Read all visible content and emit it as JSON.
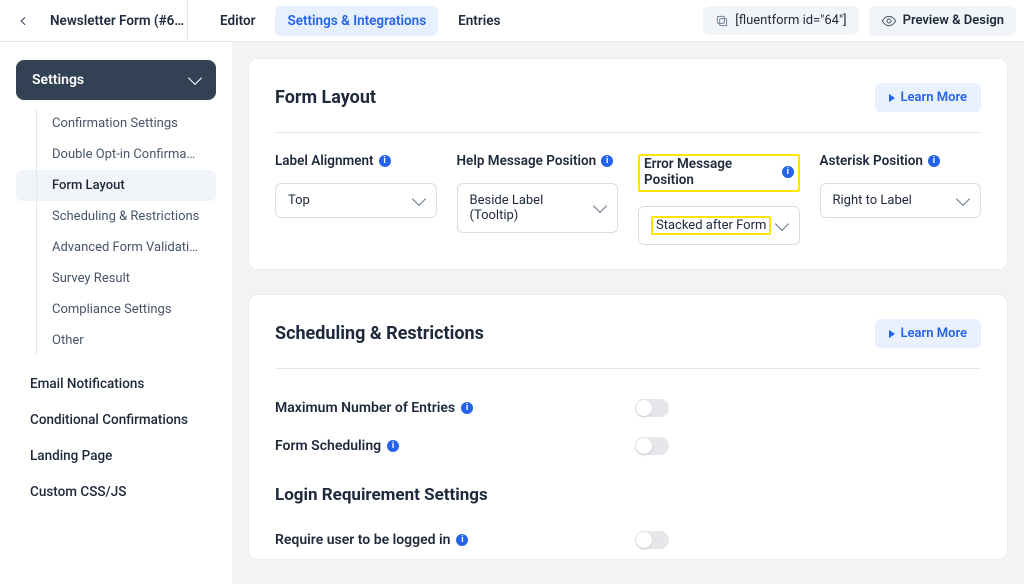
{
  "header": {
    "form_title": "Newsletter Form (#6…",
    "tabs": [
      "Editor",
      "Settings & Integrations",
      "Entries"
    ],
    "shortcode": "[fluentform id=\"64\"]",
    "preview": "Preview & Design"
  },
  "sidebar": {
    "title": "Settings",
    "tree": [
      "Confirmation Settings",
      "Double Opt-in Confirma…",
      "Form Layout",
      "Scheduling & Restrictions",
      "Advanced Form Validati…",
      "Survey Result",
      "Compliance Settings",
      "Other"
    ],
    "links": [
      "Email Notifications",
      "Conditional Confirmations",
      "Landing Page",
      "Custom CSS/JS"
    ]
  },
  "form_layout": {
    "title": "Form Layout",
    "learn_more": "Learn More",
    "fields": [
      {
        "label": "Label Alignment",
        "value": "Top"
      },
      {
        "label": "Help Message Position",
        "value": "Beside Label (Tooltip)"
      },
      {
        "label": "Error Message Position",
        "value": "Stacked after Form"
      },
      {
        "label": "Asterisk Position",
        "value": "Right to Label"
      }
    ]
  },
  "scheduling": {
    "title": "Scheduling & Restrictions",
    "learn_more": "Learn More",
    "settings": [
      {
        "label": "Maximum Number of Entries"
      },
      {
        "label": "Form Scheduling"
      }
    ]
  },
  "login": {
    "title": "Login Requirement Settings",
    "setting": "Require user to be logged in"
  }
}
